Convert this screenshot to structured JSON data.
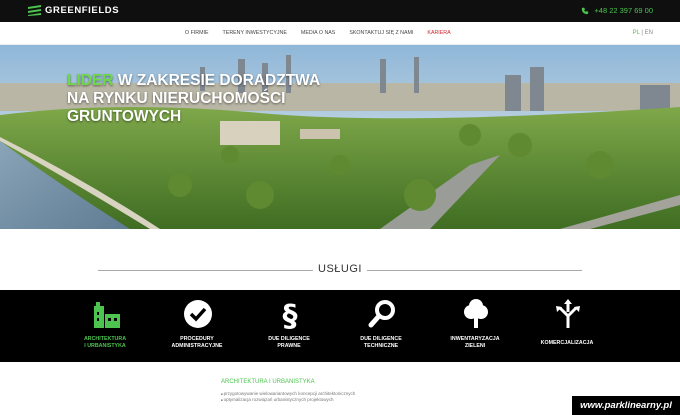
{
  "header": {
    "logo_text": "GREENFIELDS",
    "phone": "+48 22 397 69 00"
  },
  "nav": {
    "items": [
      {
        "label": "O FIRMIE"
      },
      {
        "label": "TERENY INWESTYCYJNE"
      },
      {
        "label": "MEDIA O NAS"
      },
      {
        "label": "SKONTAKTUJ SIĘ Z NAMI"
      },
      {
        "label": "KARIERA"
      }
    ],
    "lang_pl": "PL",
    "lang_sep": "|",
    "lang_en": "EN"
  },
  "hero": {
    "highlight": "LIDER",
    "title_rest": " W ZAKRESIE DORADZTWA NA RYNKU NIERUCHOMOŚCI GRUNTOWYCH"
  },
  "services": {
    "heading": "USŁUGI",
    "items": [
      {
        "line1": "ARCHITEKTURA",
        "line2": "I URBANISTYKA",
        "icon": "building-icon",
        "active": true
      },
      {
        "line1": "PROCEDURY",
        "line2": "ADMINISTRACYJNE",
        "icon": "checkmark-icon"
      },
      {
        "line1": "DUE DILIGENCE",
        "line2": "PRAWNE",
        "icon": "section-icon"
      },
      {
        "line1": "DUE DILIGENCE",
        "line2": "TECHNICZNE",
        "icon": "magnifier-icon"
      },
      {
        "line1": "INWENTARYZACJA",
        "line2": "ZIELENI",
        "icon": "tree-icon"
      },
      {
        "line1": "KOMERCJALIZACJA",
        "line2": "",
        "icon": "split-arrows-icon"
      }
    ]
  },
  "detail": {
    "title": "ARCHITEKTURA I URBANISTYKA",
    "bullets": [
      "przygotowywanie wielowariantowych koncepcji architektonicznych",
      "optymalizacja rozwiązań urbanistycznych projektowych"
    ]
  },
  "watermark": "www.parklinearny.pl",
  "colors": {
    "accent": "#4cc44f",
    "active_nav": "#d0242b",
    "dark": "#0f0f0f"
  }
}
